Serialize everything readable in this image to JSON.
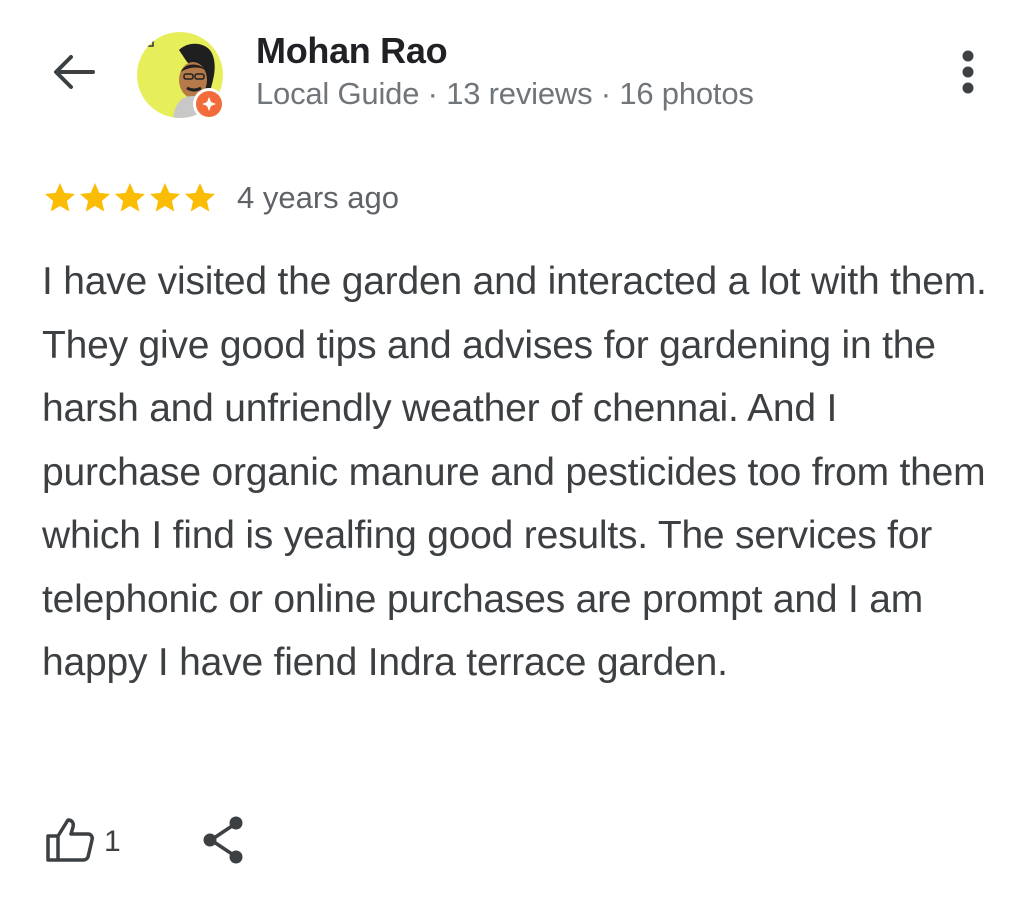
{
  "header": {
    "back_icon": "arrow-left-icon",
    "author_name": "Mohan Rao",
    "author_meta": "Local Guide · 13 reviews · 16 photos",
    "more_icon": "more-vert-icon",
    "avatar_bg": "#e6ee5a",
    "badge_color": "#f26b3a"
  },
  "review": {
    "stars": 5,
    "star_color": "#fbbc04",
    "time": "4 years ago",
    "text": "I have visited the garden and interacted a lot with them. They give good tips and advises for gardening in the harsh and unfriendly weather of chennai. And I purchase organic manure and pesticides too from them which I find is yealfing good results. The services for telephonic or online purchases are prompt and I am happy I have fiend Indra terrace garden."
  },
  "actions": {
    "like_icon": "thumb-up-icon",
    "like_count": "1",
    "share_icon": "share-icon"
  }
}
